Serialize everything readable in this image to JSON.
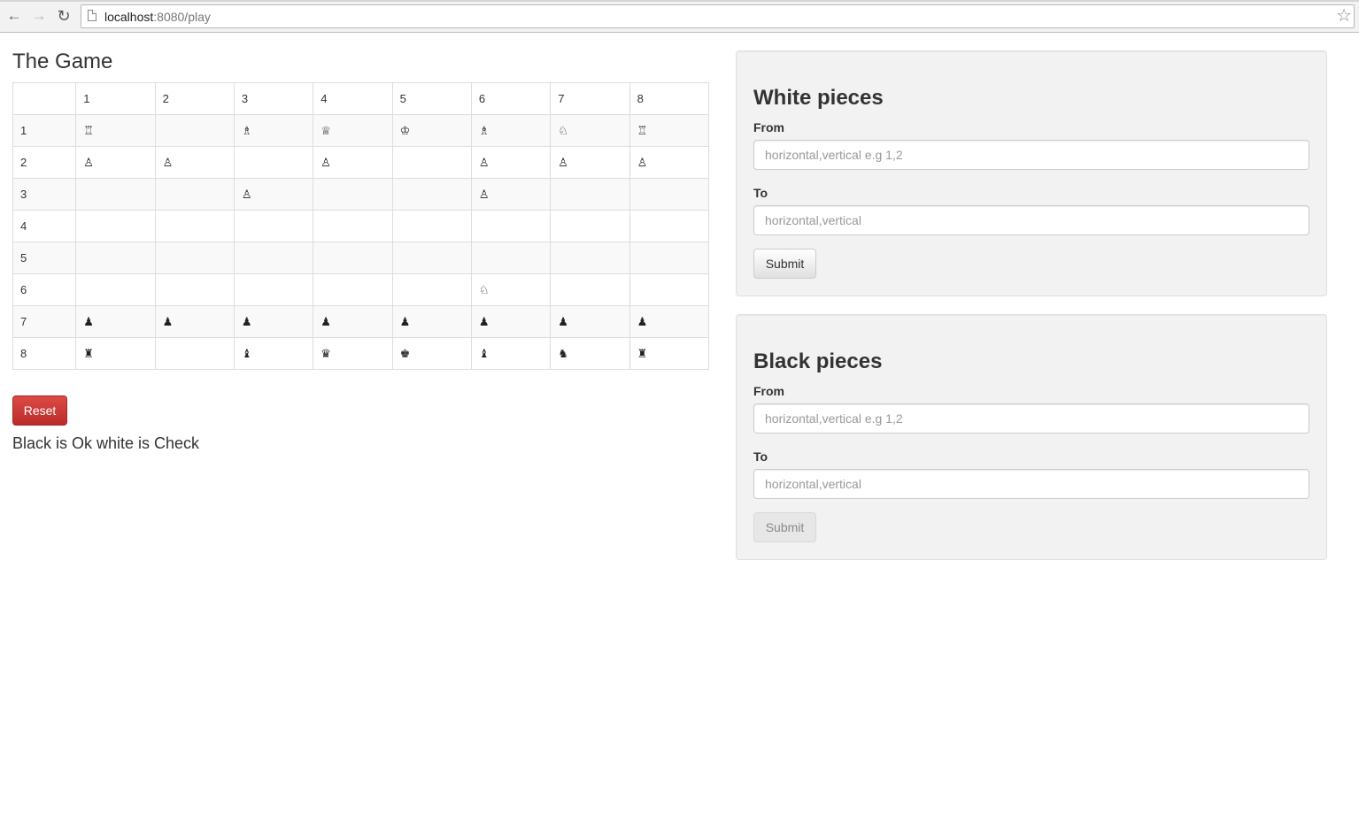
{
  "browser": {
    "url_host": "localhost",
    "url_rest": ":8080/play"
  },
  "game": {
    "title": "The Game",
    "column_headers": [
      "",
      "1",
      "2",
      "3",
      "4",
      "5",
      "6",
      "7",
      "8"
    ],
    "rows": [
      {
        "label": "1",
        "cells": [
          "♖",
          "",
          "♗",
          "♕",
          "♔",
          "♗",
          "♘",
          "♖"
        ]
      },
      {
        "label": "2",
        "cells": [
          "♙",
          "♙",
          "",
          "♙",
          "",
          "♙",
          "♙",
          "♙"
        ]
      },
      {
        "label": "3",
        "cells": [
          "",
          "",
          "♙",
          "",
          "",
          "♙",
          "",
          ""
        ]
      },
      {
        "label": "4",
        "cells": [
          "",
          "",
          "",
          "",
          "",
          "",
          "",
          ""
        ]
      },
      {
        "label": "5",
        "cells": [
          "",
          "",
          "",
          "",
          "",
          "",
          "",
          ""
        ]
      },
      {
        "label": "6",
        "cells": [
          "",
          "",
          "",
          "",
          "",
          "♘",
          "",
          ""
        ]
      },
      {
        "label": "7",
        "cells": [
          "♟",
          "♟",
          "♟",
          "♟",
          "♟",
          "♟",
          "♟",
          "♟"
        ]
      },
      {
        "label": "8",
        "cells": [
          "♜",
          "",
          "♝",
          "♛",
          "♚",
          "♝",
          "♞",
          "♜"
        ]
      }
    ],
    "reset_label": "Reset",
    "status": "Black is Ok white is Check"
  },
  "white_panel": {
    "title": "White pieces",
    "from_label": "From",
    "from_placeholder": "horizontal,vertical e.g 1,2",
    "to_label": "To",
    "to_placeholder": "horizontal,vertical",
    "submit_label": "Submit"
  },
  "black_panel": {
    "title": "Black pieces",
    "from_label": "From",
    "from_placeholder": "horizontal,vertical e.g 1,2",
    "to_label": "To",
    "to_placeholder": "horizontal,vertical",
    "submit_label": "Submit",
    "submit_disabled": true
  },
  "colors": {
    "reset_button": "#d9534f",
    "panel_background": "#f2f2f2"
  }
}
